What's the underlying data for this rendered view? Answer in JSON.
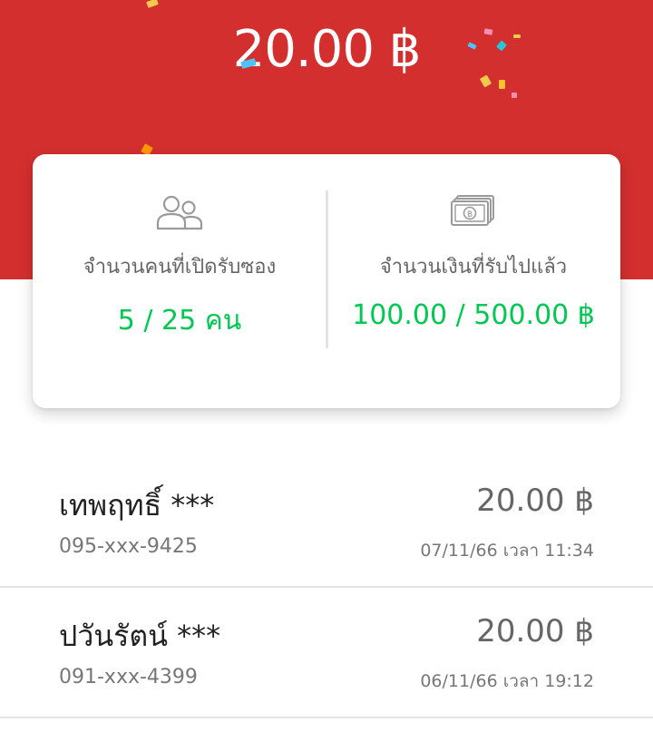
{
  "header": {
    "amount": "20.00 ฿",
    "background_color": "#d32f2f"
  },
  "edge_glyph": "",
  "summary": {
    "opened": {
      "icon": "people-icon",
      "label": "จำนวนคนที่เปิดรับซอง",
      "value": "5 / 25 คน"
    },
    "received": {
      "icon": "banknote-icon",
      "label": "จำนวนเงินที่รับไปแล้ว",
      "value": "100.00 / 500.00 ฿"
    },
    "value_color": "#00c853"
  },
  "recipients": [
    {
      "name": "เทพฤทธิ์ ***",
      "phone": "095-xxx-9425",
      "amount": "20.00 ฿",
      "time": "07/11/66 เวลา 11:34"
    },
    {
      "name": "ปวันรัตน์ ***",
      "phone": "091-xxx-4399",
      "amount": "20.00 ฿",
      "time": "06/11/66 เวลา 19:12"
    }
  ]
}
